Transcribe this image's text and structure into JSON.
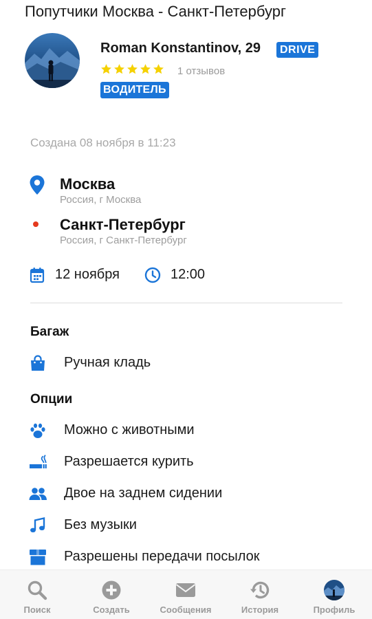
{
  "page": {
    "title": "Попутчики Москва - Санкт-Петербург"
  },
  "driver": {
    "name": "Roman Konstantinov, 29",
    "badge": "DRIVE",
    "rating_stars": 5,
    "reviews": "1 отзывов",
    "role": "ВОДИТЕЛЬ"
  },
  "trip": {
    "created": "Создана 08 ноября в 11:23",
    "from": {
      "city": "Москва",
      "region": "Россия, г Москва"
    },
    "to": {
      "city": "Санкт-Петербург",
      "region": "Россия, г Санкт-Петербург"
    },
    "date": "12 ноября",
    "time": "12:00"
  },
  "luggage": {
    "title": "Багаж",
    "items": [
      {
        "label": "Ручная кладь",
        "icon": "bag-icon"
      }
    ]
  },
  "options": {
    "title": "Опции",
    "items": [
      {
        "label": "Можно с животными",
        "icon": "paw-icon"
      },
      {
        "label": "Разрешается курить",
        "icon": "smoking-icon"
      },
      {
        "label": "Двое на заднем сидении",
        "icon": "users-icon"
      },
      {
        "label": "Без музыки",
        "icon": "music-icon"
      },
      {
        "label": "Разрешены передачи посылок",
        "icon": "box-icon"
      }
    ]
  },
  "nav": {
    "items": [
      {
        "label": "Поиск",
        "icon": "search-icon"
      },
      {
        "label": "Создать",
        "icon": "plus-circle-icon"
      },
      {
        "label": "Сообщения",
        "icon": "envelope-icon"
      },
      {
        "label": "История",
        "icon": "history-icon"
      },
      {
        "label": "Профиль",
        "icon": "avatar"
      }
    ]
  },
  "colors": {
    "accent": "#1b75d8",
    "star": "#f5d100",
    "destination_dot": "#e53a1e",
    "muted": "#9d9d9d",
    "nav_inactive": "#9a9a9a"
  }
}
